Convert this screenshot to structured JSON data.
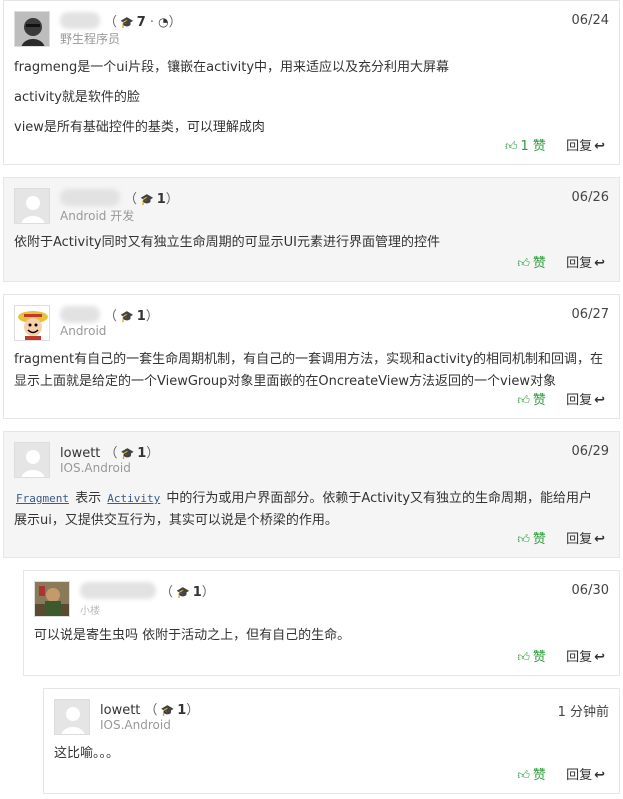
{
  "comments": [
    {
      "name": "",
      "rank": "7",
      "extra_icon": "weibo-icon",
      "subtitle": "野生程序员",
      "date": "06/24",
      "paragraphs": [
        "fragmeng是一个ui片段，镶嵌在activity中，用来适应以及充分利用大屏幕",
        "activity就是软件的脸",
        "view是所有基础控件的基类，可以理解成肉"
      ],
      "likes": "1",
      "like_label": "赞",
      "reply_label": "回复"
    },
    {
      "name": "",
      "rank": "1",
      "subtitle": "Android 开发",
      "date": "06/26",
      "paragraphs": [
        "依附于Activity同时又有独立生命周期的可显示UI元素进行界面管理的控件"
      ],
      "like_label": "赞",
      "reply_label": "回复"
    },
    {
      "name": "",
      "rank": "1",
      "subtitle": "Android",
      "date": "06/27",
      "paragraphs": [
        "fragment有自己的一套生命周期机制，有自己的一套调用方法，实现和activity的相同机制和回调，在显示上面就是给定的一个ViewGroup对象里面嵌的在OncreateView方法返回的一个view对象"
      ],
      "like_label": "赞",
      "reply_label": "回复"
    },
    {
      "name": "lowett",
      "rank": "1",
      "subtitle": "IOS.Android",
      "date": "06/29",
      "code1": "Fragment",
      "text1": "表示",
      "code2": "Activity",
      "text2": "中的行为或用户界面部分。依赖于Activity又有独立的生命周期，能给用户展示ui，又提供交互行为，其实可以说是个桥梁的作用。",
      "like_label": "赞",
      "reply_label": "回复"
    },
    {
      "name": "",
      "rank": "1",
      "subtitle": "小楼",
      "date": "06/30",
      "paragraphs": [
        "可以说是寄生虫吗 依附于活动之上，但有自己的生命。"
      ],
      "like_label": "赞",
      "reply_label": "回复"
    },
    {
      "name": "lowett",
      "rank": "1",
      "subtitle": "IOS.Android",
      "date": "1 分钟前",
      "paragraphs": [
        "这比喻。。。"
      ],
      "like_label": "赞",
      "reply_label": "回复"
    }
  ]
}
